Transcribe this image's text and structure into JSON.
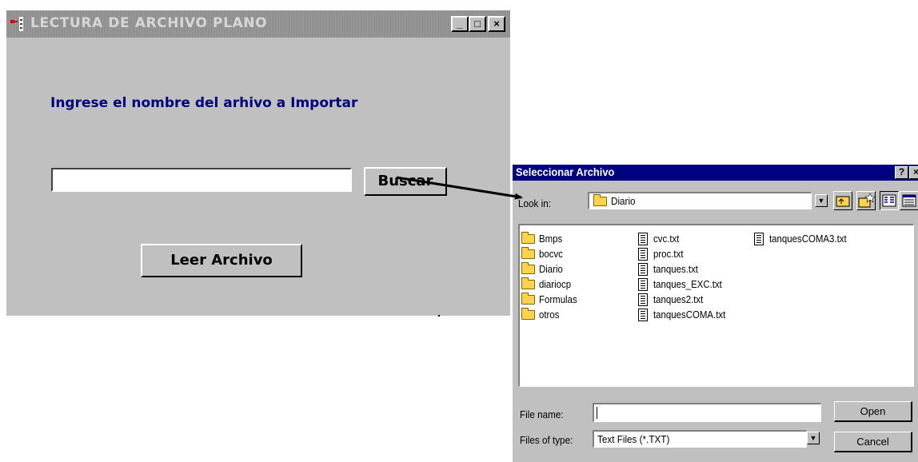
{
  "main_window": {
    "title": "LECTURA DE ARCHIVO PLANO",
    "controls": {
      "minimize": "_",
      "maximize": "□",
      "close": "×"
    },
    "prompt": "Ingrese el nombre del arhivo a Importar",
    "filename_value": "",
    "browse_button": "Buscar",
    "read_button": "Leer Archivo"
  },
  "dialog": {
    "title": "Seleccionar Archivo",
    "controls": {
      "help": "?",
      "close": "×"
    },
    "look_in_label": "Look in:",
    "look_in_value": "Diario",
    "files": [
      {
        "name": "Bmps",
        "type": "folder"
      },
      {
        "name": "bocvc",
        "type": "folder"
      },
      {
        "name": "Diario",
        "type": "folder"
      },
      {
        "name": "diariocp",
        "type": "folder"
      },
      {
        "name": "Formulas",
        "type": "folder"
      },
      {
        "name": "otros",
        "type": "folder"
      },
      {
        "name": "cvc.txt",
        "type": "file"
      },
      {
        "name": "proc.txt",
        "type": "file"
      },
      {
        "name": "tanques.txt",
        "type": "file"
      },
      {
        "name": "tanques_EXC.txt",
        "type": "file"
      },
      {
        "name": "tanques2.txt",
        "type": "file"
      },
      {
        "name": "tanquesCOMA.txt",
        "type": "file"
      },
      {
        "name": "tanquesCOMA3.txt",
        "type": "file"
      }
    ],
    "file_name_label": "File name:",
    "file_name_value": "",
    "file_type_label": "Files of type:",
    "file_type_value": "Text Files (*.TXT)",
    "open_button": "Open",
    "cancel_button": "Cancel"
  },
  "colors": {
    "title_active": "#000080",
    "prompt": "#000080",
    "face": "#c0c0c0"
  }
}
